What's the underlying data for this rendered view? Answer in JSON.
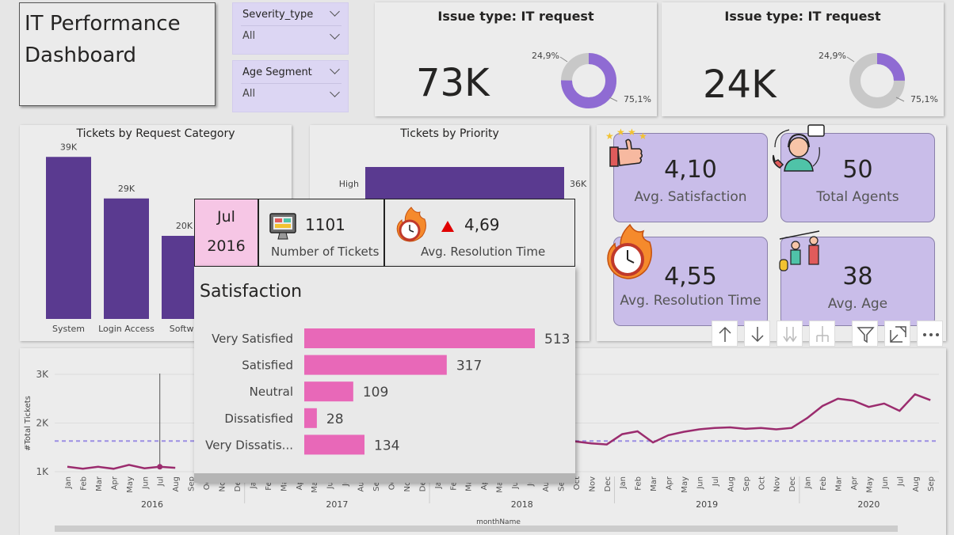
{
  "title": {
    "line1": "IT Performance",
    "line2": "Dashboard"
  },
  "slicers": [
    {
      "label": "Severity_type",
      "value": "All"
    },
    {
      "label": "Age Segment",
      "value": "All"
    }
  ],
  "kpis": [
    {
      "title": "Issue type: IT request",
      "value": "73K",
      "pct_a": "24,9%",
      "pct_b": "75,1%",
      "fraction": 0.751,
      "color": "#8f6bd3"
    },
    {
      "title": "Issue type: IT request",
      "value": "24K",
      "pct_a": "24,9%",
      "pct_b": "75,1%",
      "fraction": 0.249,
      "color": "#8f6bd3"
    }
  ],
  "tiles": [
    {
      "value": "4,10",
      "label": "Avg. Satisfaction"
    },
    {
      "value": "50",
      "label": "Total Agents"
    },
    {
      "value": "4,55",
      "label": "Avg. Resolution Time"
    },
    {
      "value": "38",
      "label": "Avg. Age"
    }
  ],
  "tooltip": {
    "month": "Jul",
    "year": "2016",
    "tickets_value": "1101",
    "tickets_label": "Number of Tickets",
    "resolution_value": "4,69",
    "resolution_label": "Avg. Resolution Time",
    "satisfaction_title": "Satisfaction"
  },
  "colors": {
    "bar": "#5a3a90",
    "pink": "#e868b8",
    "line": "#9b2c6e",
    "avg": "#9b8ee3"
  },
  "chart_data": [
    {
      "type": "bar",
      "title": "Tickets by Request Category",
      "categories": [
        "System",
        "Login Access",
        "Softwa"
      ],
      "values": [
        39,
        29,
        20
      ],
      "data_labels": [
        "39K",
        "29K",
        "20K"
      ]
    },
    {
      "type": "bar",
      "title": "Tickets by Priority",
      "orientation": "horizontal",
      "categories": [
        "High"
      ],
      "values": [
        36
      ],
      "data_labels": [
        "36K"
      ]
    },
    {
      "type": "bar",
      "title": "Satisfaction",
      "orientation": "horizontal",
      "categories": [
        "Very Satisfied",
        "Satisfied",
        "Neutral",
        "Dissatisfied",
        "Very Dissatis..."
      ],
      "values": [
        513,
        317,
        109,
        28,
        134
      ],
      "data_labels": [
        "513",
        "317",
        "109",
        "28",
        "134"
      ]
    },
    {
      "type": "line",
      "ylabel": "#Total Tickets",
      "xlabel": "monthName",
      "yticks": [
        "3K",
        "2K",
        "1K"
      ],
      "ylim": [
        1000,
        3000
      ],
      "average": 1630,
      "years": [
        "2016",
        "2017",
        "2018",
        "2019",
        "2020"
      ],
      "months": [
        "Jan",
        "Feb",
        "Mar",
        "Apr",
        "May",
        "Jun",
        "Jul",
        "Aug",
        "Sep",
        "Oct",
        "Nov",
        "Dec",
        "Jan",
        "Feb",
        "Mar",
        "Apr",
        "May",
        "Jun",
        "Jul",
        "Aug",
        "Sep",
        "Oct",
        "Nov",
        "Dec",
        "Jan",
        "Feb",
        "Mar",
        "Apr",
        "May",
        "Jun",
        "Jul",
        "Aug",
        "Sep",
        "Oct",
        "Nov",
        "Dec",
        "Jan",
        "Feb",
        "Mar",
        "Apr",
        "May",
        "Jun",
        "Jul",
        "Aug",
        "Sep",
        "Oct",
        "Nov",
        "Dec",
        "Jan",
        "Feb",
        "Mar",
        "Apr",
        "May",
        "Jun",
        "Jul",
        "Aug",
        "Sep"
      ],
      "values": [
        1101,
        1060,
        1100,
        1060,
        1140,
        1070,
        1101,
        1080,
        null,
        null,
        null,
        null,
        null,
        null,
        null,
        null,
        null,
        null,
        null,
        null,
        null,
        null,
        null,
        null,
        null,
        null,
        null,
        null,
        null,
        null,
        null,
        null,
        1650,
        1620,
        1580,
        1560,
        1770,
        1830,
        1600,
        1750,
        1820,
        1870,
        1900,
        1910,
        1880,
        1900,
        1870,
        1900,
        2100,
        2350,
        2500,
        2460,
        2330,
        2400,
        2250,
        2590,
        2470
      ]
    }
  ]
}
